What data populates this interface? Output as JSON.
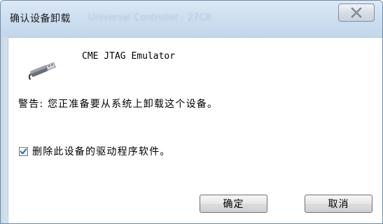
{
  "window": {
    "title": "确认设备卸载",
    "background_title_ghost": "Universal Controller - 27C8",
    "close_icon": "close-x-icon"
  },
  "device": {
    "name": "CME JTAG Emulator",
    "icon": "usb-plug-icon"
  },
  "warning_text": "警告: 您正准备要从系统上卸载这个设备。",
  "delete_driver": {
    "label": "删除此设备的驱动程序软件。",
    "checked": true
  },
  "buttons": {
    "ok": "确定",
    "cancel": "取消"
  },
  "colors": {
    "titlebar": "#cfe0f1",
    "border": "#6d8aa8",
    "checkmark": "#2a5aa0"
  }
}
